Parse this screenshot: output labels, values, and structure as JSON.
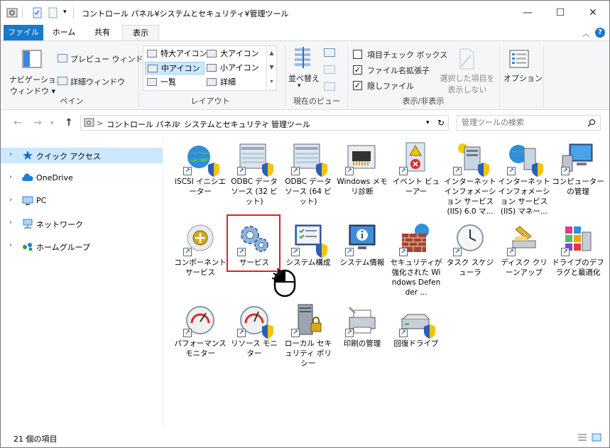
{
  "window": {
    "title": "コントロール パネル¥システムとセキュリティ¥管理ツール",
    "controls": {
      "minimize": "—",
      "maximize": "☐",
      "close": "✕"
    }
  },
  "ribbon_tabs": [
    {
      "label": "ファイル"
    },
    {
      "label": "ホーム"
    },
    {
      "label": "共有"
    },
    {
      "label": "表示"
    }
  ],
  "ribbon": {
    "pane": {
      "nav_pane_label_line1": "ナビゲーション",
      "nav_pane_label_line2": "ウィンドウ ▾",
      "preview_pane": "プレビュー ウィンドウ",
      "details_pane": "詳細ウィンドウ",
      "group": "ペイン"
    },
    "layout": {
      "items": [
        "特大アイコン",
        "大アイコン",
        "中アイコン",
        "小アイコン",
        "一覧",
        "詳細"
      ],
      "selected": "中アイコン",
      "group": "レイアウト"
    },
    "current_view": {
      "sort_by": "並べ替え",
      "group": "現在のビュー"
    },
    "show_hide": {
      "item_checkboxes": "項目チェック ボックス",
      "file_extensions": "ファイル名拡張子",
      "hidden_items": "隠しファイル",
      "item_checkboxes_checked": "",
      "file_extensions_checked": "✓",
      "hidden_items_checked": "✓",
      "hide_selected_line1": "選択した項目を",
      "hide_selected_line2": "表示しない",
      "group": "表示/非表示"
    },
    "options": {
      "label": "オプション"
    }
  },
  "address": {
    "crumbs": [
      "コントロール パネル",
      "システムとセキュリティ",
      "管理ツール"
    ],
    "separator": ">",
    "search_placeholder": "管理ツールの検索"
  },
  "nav_pane": [
    {
      "label": "クイック アクセス",
      "icon": "star-icon",
      "color": "#1e6fc7"
    },
    {
      "label": "OneDrive",
      "icon": "cloud-icon",
      "color": "#1f7be0"
    },
    {
      "label": "PC",
      "icon": "pc-icon",
      "color": "#3a86d6"
    },
    {
      "label": "ネットワーク",
      "icon": "network-icon",
      "color": "#3a86d6"
    },
    {
      "label": "ホームグループ",
      "icon": "homegroup-icon",
      "color": "#2a9d4a"
    }
  ],
  "items": [
    {
      "label": "iSCSI イニシエーター",
      "icon": "globe-icon"
    },
    {
      "label": "ODBC データソース (32 ビット)",
      "icon": "database-icon"
    },
    {
      "label": "ODBC データソース (64 ビット)",
      "icon": "database-icon"
    },
    {
      "label": "Windows メモリ診断",
      "icon": "memory-icon"
    },
    {
      "label": "イベント ビューアー",
      "icon": "event-viewer-icon"
    },
    {
      "label": "インターネット インフォメーション サービス (IIS) 6.0 マ...",
      "icon": "iis-icon"
    },
    {
      "label": "インターネット インフォメーション サービス (IIS) マネー...",
      "icon": "iis-manager-icon"
    },
    {
      "label": "コンピューターの管理",
      "icon": "computer-management-icon"
    },
    {
      "label": "コンポーネント サービス",
      "icon": "component-services-icon"
    },
    {
      "label": "サービス",
      "icon": "services-gears-icon"
    },
    {
      "label": "システム構成",
      "icon": "system-config-icon"
    },
    {
      "label": "システム情報",
      "icon": "system-info-icon"
    },
    {
      "label": "セキュリティが強化された Windows Defender ...",
      "icon": "firewall-icon"
    },
    {
      "label": "タスク スケジューラ",
      "icon": "clock-icon"
    },
    {
      "label": "ディスク クリーンアップ",
      "icon": "disk-cleanup-icon"
    },
    {
      "label": "ドライブのデフラグと最適化",
      "icon": "defrag-icon"
    },
    {
      "label": "パフォーマンス モニター",
      "icon": "gauge-icon"
    },
    {
      "label": "リソース モニター",
      "icon": "resource-gauge-icon"
    },
    {
      "label": "ローカル セキュリティ ポリシー",
      "icon": "server-lock-icon"
    },
    {
      "label": "印刷の管理",
      "icon": "printer-icon"
    },
    {
      "label": "回復ドライブ",
      "icon": "recovery-drive-icon"
    }
  ],
  "status": {
    "count": "21 個の項目"
  },
  "colors": {
    "accent": "#1979ca",
    "highlight_box": "#e02020",
    "selection": "#cce8ff"
  }
}
